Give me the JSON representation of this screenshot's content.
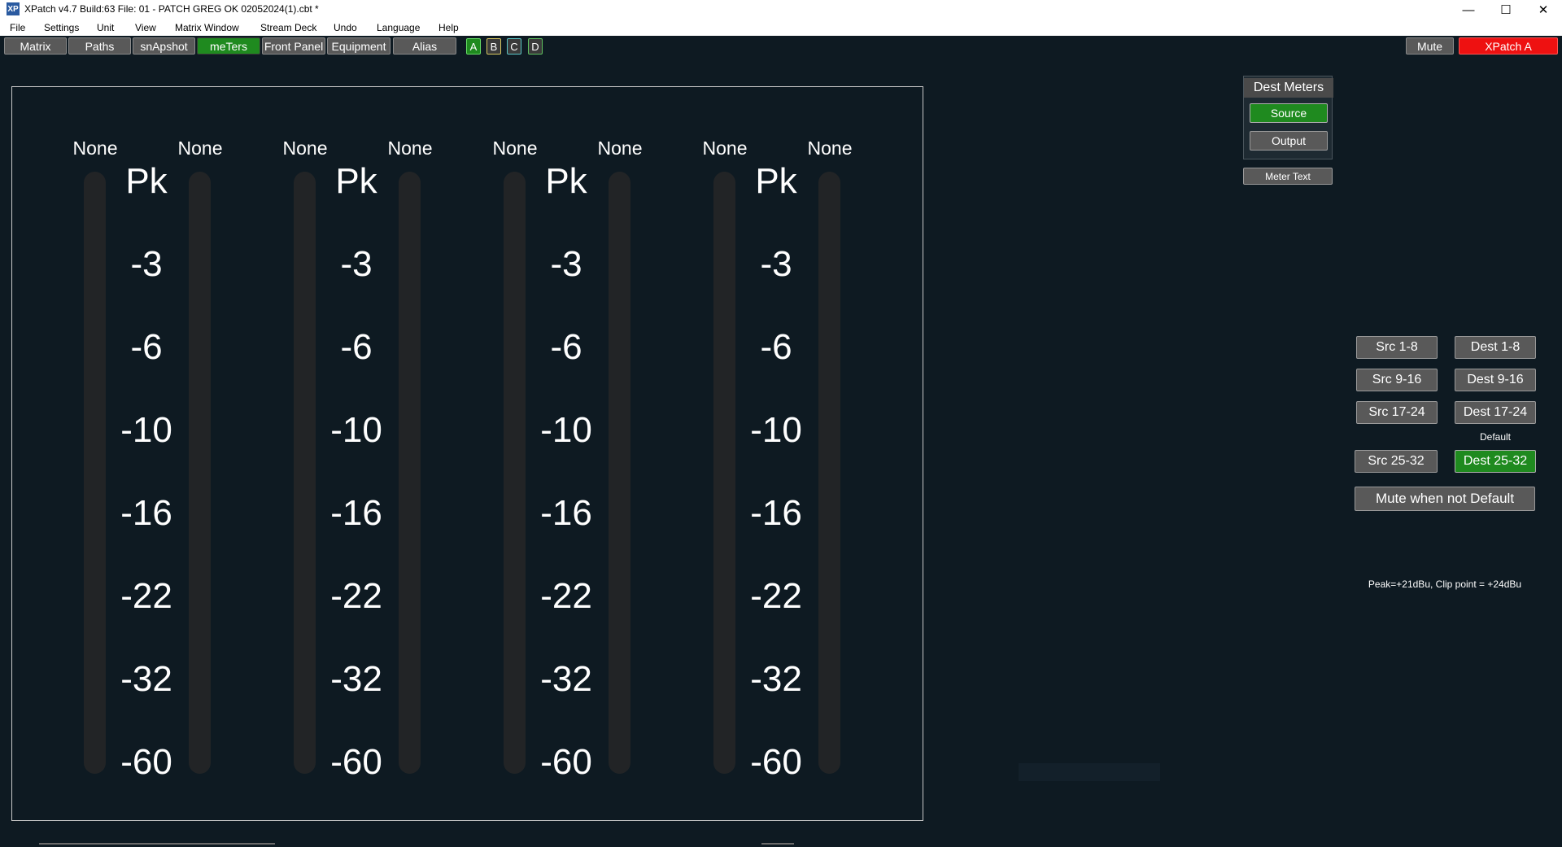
{
  "window": {
    "title": "XPatch v4.7 Build:63  File: 01 - PATCH GREG OK 02052024(1).cbt *",
    "icon_label": "XP",
    "controls": {
      "minimize": "—",
      "maximize": "☐",
      "close": "✕"
    }
  },
  "menu": [
    "File",
    "Settings",
    "Unit",
    "View",
    "Matrix Window",
    "Stream Deck",
    "Undo",
    "Language",
    "Help"
  ],
  "toolbar": {
    "tabs": [
      "Matrix",
      "Paths",
      "snApshot",
      "meTers",
      "Front Panel",
      "Equipment",
      "Alias"
    ],
    "active_tab": "meTers",
    "units": [
      "A",
      "B",
      "C",
      "D"
    ],
    "mute_label": "Mute",
    "xpatch_label": "XPatch A"
  },
  "meters": {
    "channels": [
      {
        "left": "None",
        "right": "None"
      },
      {
        "left": "None",
        "right": "None"
      },
      {
        "left": "None",
        "right": "None"
      },
      {
        "left": "None",
        "right": "None"
      }
    ],
    "scale": [
      "Pk",
      "-3",
      "-6",
      "-10",
      "-16",
      "-22",
      "-32",
      "-60"
    ]
  },
  "dest_meters": {
    "title": "Dest Meters",
    "source_label": "Source",
    "output_label": "Output",
    "meter_text_label": "Meter Text"
  },
  "banks": {
    "src": [
      "Src  1-8",
      "Src  9-16",
      "Src  17-24",
      "Src 25-32"
    ],
    "dest": [
      "Dest 1-8",
      "Dest 9-16",
      "Dest 17-24",
      "Dest 25-32"
    ],
    "default_label": "Default",
    "active_dest": "Dest 25-32",
    "mute_when_not_default": "Mute when not Default"
  },
  "info": {
    "peak_text": "Peak=+21dBu, Clip point = +24dBu"
  },
  "colors": {
    "background": "#0e1a22",
    "active_green": "#1f8a1f",
    "xpatch_red": "#ee1111",
    "button_gray": "#595959"
  }
}
